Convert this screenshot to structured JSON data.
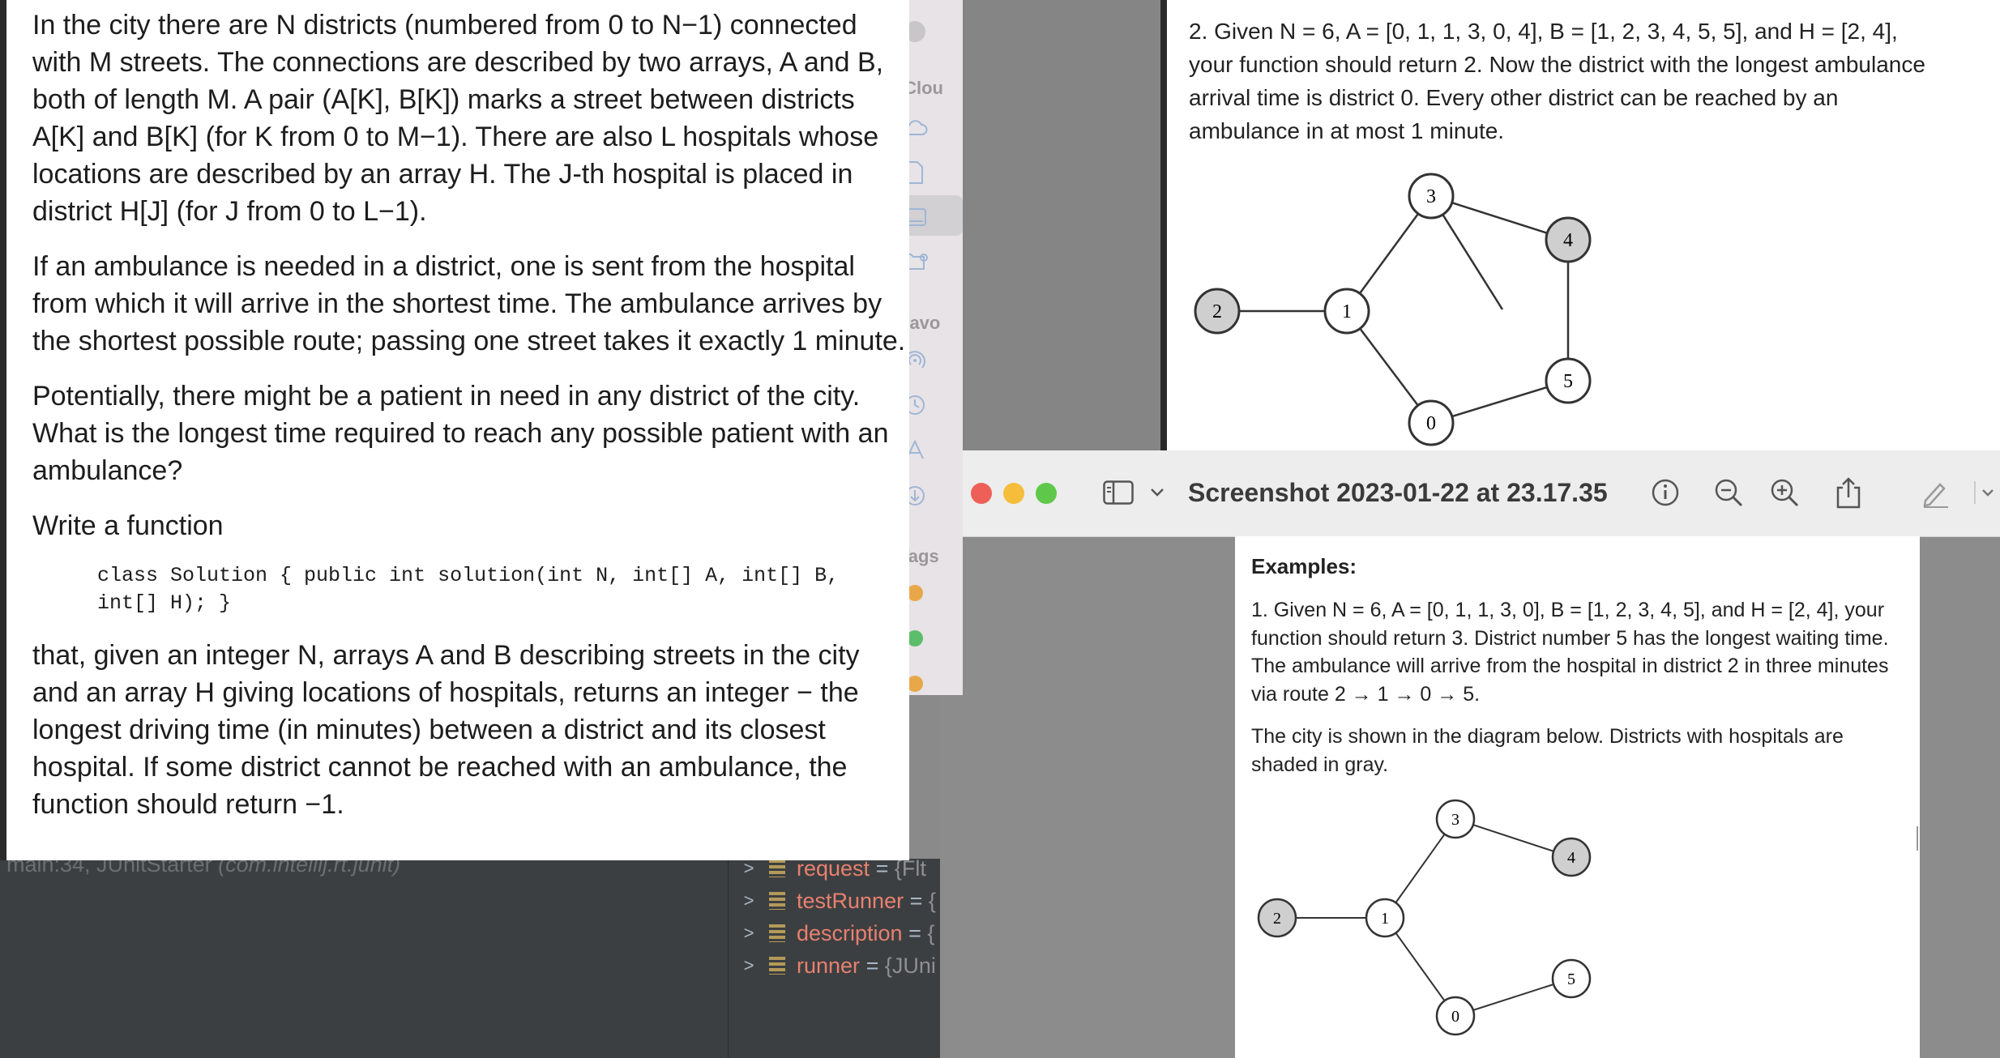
{
  "problem": {
    "para1": "In the city there are N districts (numbered from 0 to N−1) connected with M streets. The connections are described by two arrays, A and B, both of length M. A pair (A[K], B[K]) marks a street between districts A[K] and B[K] (for K from 0 to M−1). There are also L hospitals whose locations are described by an array H. The J-th hospital is placed in district H[J] (for J from 0 to L−1).",
    "para2": "If an ambulance is needed in a district, one is sent from the hospital from which it will arrive in the shortest time. The ambulance arrives by the shortest possible route; passing one street takes it exactly 1 minute.",
    "para3": "Potentially, there might be a patient in need in any district of the city. What is the longest time required to reach any possible patient with an ambulance?",
    "para4": "Write a function",
    "code": "class Solution { public int solution(int N, int[] A, int[] B,\nint[] H); }",
    "para5": "that, given an integer N, arrays A and B describing streets in the city and an array H giving locations of hospitals, returns an integer − the longest driving time (in minutes) between a district and its closest hospital. If some district cannot be reached with an ambulance, the function should return −1."
  },
  "ide": {
    "stack_frame_prefix": "main:34, JUnitStarter",
    "stack_frame_pkg": "(com.intellij.rt.junit)",
    "variables": [
      {
        "name": "request",
        "eq": "=",
        "value": "{Flt"
      },
      {
        "name": "testRunner",
        "eq": "=",
        "value": "{"
      },
      {
        "name": "description",
        "eq": "=",
        "value": "{"
      },
      {
        "name": "runner",
        "eq": "=",
        "value": "{JUni"
      }
    ]
  },
  "finder": {
    "section_icloud": "iClou",
    "section_favorites": "Favo",
    "section_tags": "Tags",
    "tag_colors": [
      "#e8a84a",
      "#5cbd6a",
      "#e8a84a"
    ]
  },
  "top_image": {
    "example2_text": "2. Given N = 6, A = [0, 1, 1, 3, 0, 4], B = [1, 2, 3, 4, 5, 5], and H = [2, 4], your function should return 2. Now the district with the longest ambulance arrival time is district 0. Every other district can be reached by an ambulance in at most 1 minute.",
    "graph": {
      "nodes": [
        "3",
        "4",
        "2",
        "1",
        "5",
        "0"
      ],
      "hospitals": [
        "2",
        "4"
      ]
    }
  },
  "preview": {
    "title": "Screenshot 2023-01-22 at 23.17.35",
    "examples_heading": "Examples:",
    "example1_text": "1. Given N = 6, A = [0, 1, 1, 3, 0], B = [1, 2, 3, 4, 5], and H = [2, 4], your function should return 3. District number 5 has the longest waiting time. The ambulance will arrive from the hospital in district 2 in three minutes via route 2 → 1 → 0 → 5.",
    "diagram_caption": "The city is shown in the diagram below. Districts with hospitals are shaded in gray.",
    "graph": {
      "nodes": [
        "3",
        "4",
        "2",
        "1",
        "5",
        "0"
      ],
      "hospitals": [
        "2",
        "4"
      ]
    },
    "traffic_colors": {
      "close": "#ee5f57",
      "minimize": "#f5bd3a",
      "zoom": "#5fc84a"
    }
  }
}
